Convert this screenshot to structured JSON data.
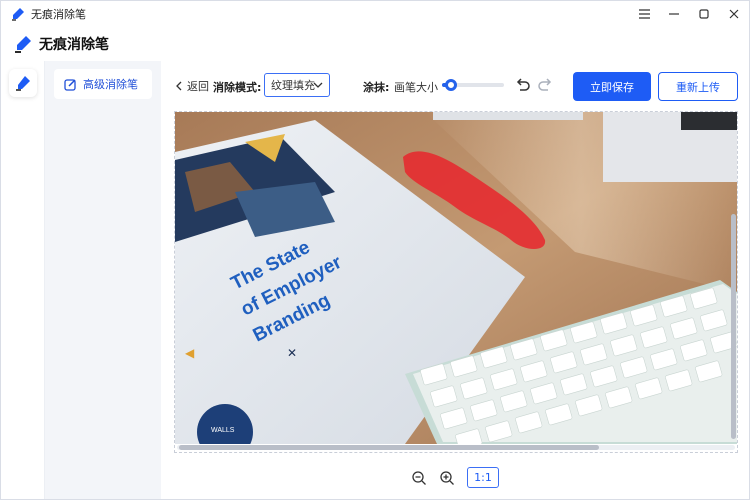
{
  "window": {
    "title": "无痕消除笔",
    "controls": [
      "menu-icon",
      "minimize-icon",
      "maximize-icon",
      "close-icon"
    ]
  },
  "app": {
    "title": "无痕消除笔"
  },
  "sidenav": {
    "items": [
      {
        "label": "高级消除笔",
        "icon": "edit-square-icon",
        "active": true
      }
    ]
  },
  "toolbar": {
    "back_label": "返回",
    "mode_label": "消除模式:",
    "mode_value": "纹理填充",
    "smear_label": "涂抹:",
    "brush_size_label": "画笔大小",
    "brush_size_value": 0.15,
    "save_label": "立即保存",
    "upload_label": "重新上传"
  },
  "canvas": {
    "image_text": {
      "line1": "The State",
      "line2": "of Employer",
      "line3": "Branding",
      "badge": "WALLS"
    }
  },
  "zoom": {
    "ratio_label": "1:1"
  },
  "colors": {
    "accent": "#1e5cf5",
    "brush_mark": "#e8262d"
  }
}
